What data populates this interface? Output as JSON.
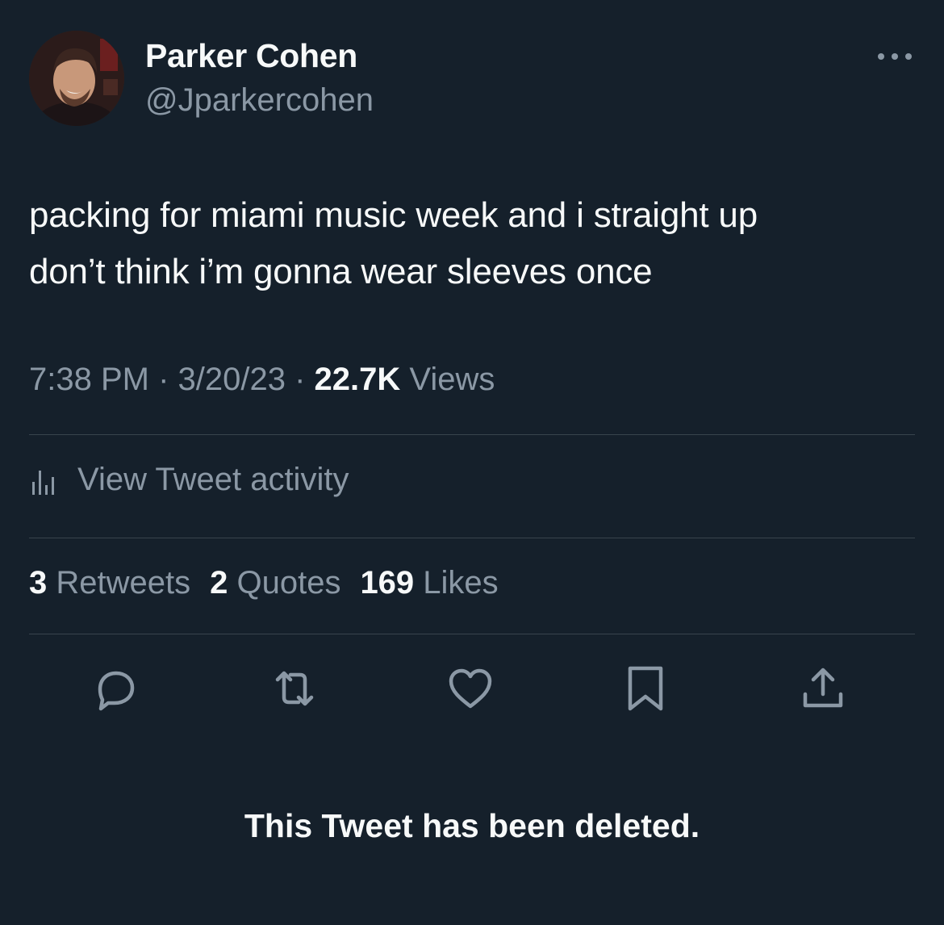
{
  "author": {
    "name": "Parker Cohen",
    "handle": "@Jparkercohen",
    "avatar_icon": "avatar-photo"
  },
  "tweet": {
    "line1": "packing for miami music week and i straight up",
    "line2": "don’t think i’m gonna wear sleeves once"
  },
  "meta": {
    "time": "7:38 PM",
    "sep1": " · ",
    "date": "3/20/23",
    "sep2": " · ",
    "views_count": "22.7K",
    "views_label": " Views"
  },
  "activity": {
    "label": "View Tweet activity",
    "icon": "bar-chart-icon"
  },
  "stats": {
    "retweets_count": "3",
    "retweets_label": " Retweets",
    "quotes_count": "2",
    "quotes_label": " Quotes",
    "likes_count": "169",
    "likes_label": " Likes"
  },
  "actions": [
    "reply-icon",
    "retweet-icon",
    "like-icon",
    "bookmark-icon",
    "share-icon"
  ],
  "notice": "This Tweet has been deleted.",
  "colors": {
    "background": "#15202b",
    "primary_text": "#f7f9f9",
    "secondary_text": "#8b98a5",
    "divider": "#38444d"
  }
}
